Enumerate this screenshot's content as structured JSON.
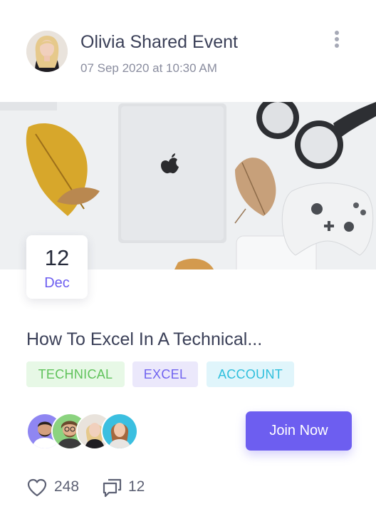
{
  "post": {
    "author": "Olivia Shared Event",
    "timestamp": "07 Sep 2020 at 10:30 AM"
  },
  "event": {
    "date_day": "12",
    "date_month": "Dec",
    "title": "How To Excel In A Technical...",
    "tags": [
      {
        "label": "TECHNICAL",
        "color": "#5fc25a"
      },
      {
        "label": "EXCEL",
        "color": "#7063ef"
      },
      {
        "label": "ACCOUNT",
        "color": "#2ebfdc"
      }
    ]
  },
  "actions": {
    "join_label": "Join Now"
  },
  "stats": {
    "likes": "248",
    "comments": "12"
  },
  "theme": {
    "accent": "#6d5ef0"
  },
  "icons": [
    "more-vertical-icon",
    "heart-icon",
    "comment-icon"
  ]
}
